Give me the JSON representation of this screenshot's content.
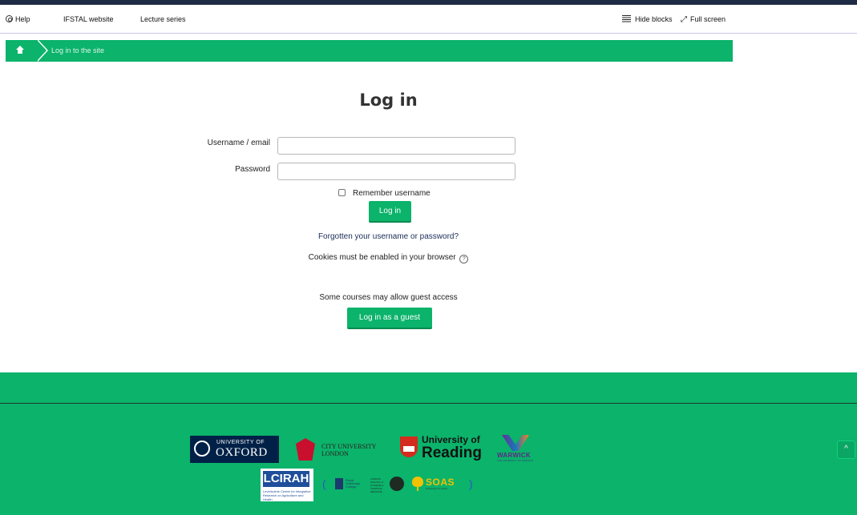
{
  "topnav": {
    "help": "Help",
    "ifstal": "IFSTAL website",
    "lectures": "Lecture series",
    "hide_blocks": "Hide blocks",
    "full_screen": "Full screen"
  },
  "breadcrumb": {
    "current": "Log in to the site"
  },
  "login": {
    "title": "Log in",
    "username_label": "Username / email",
    "username_value": "",
    "password_label": "Password",
    "password_value": "",
    "remember_label": "Remember username",
    "remember_checked": false,
    "submit_label": "Log in",
    "forgot_link": "Forgotten your username or password?",
    "cookies_text": "Cookies must be enabled in your browser",
    "cookies_help": "?",
    "guest_text": "Some courses may allow guest access",
    "guest_button": "Log in as a guest"
  },
  "footer": {
    "logos": {
      "oxford_line1": "UNIVERSITY OF",
      "oxford_line2": "OXFORD",
      "city_line1": "CITY UNIVERSITY",
      "city_line2": "LONDON",
      "reading_line1": "University of",
      "reading_line2": "Reading",
      "warwick": "WARWICK",
      "warwick_sub": "THE UNIVERSITY OF WARWICK",
      "lcirah": "LCIRAH",
      "lcirah_sub": "Leverhulme Centre for Integrative Research on Agriculture and Health",
      "rvc": "Royal Veterinary College",
      "lshtm": "LONDON SCHOOL of HYGIENE & TROPICAL MEDICINE",
      "soas": "SOAS",
      "soas_sub": "University of London",
      "paren_open": "(",
      "paren_close": ")"
    },
    "to_top": "^"
  },
  "colors": {
    "brand_green": "#0bb36b",
    "navy": "#1f2a44",
    "link": "#1a2c57"
  }
}
